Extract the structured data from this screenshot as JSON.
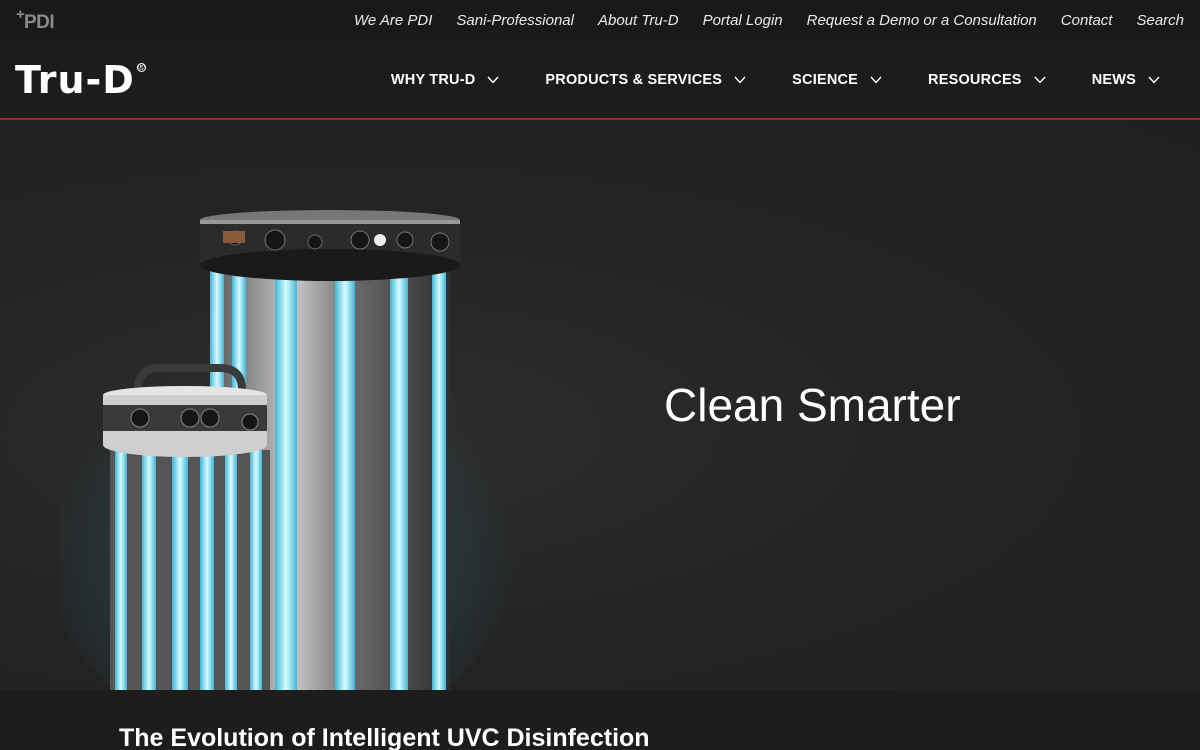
{
  "utility": {
    "brand": "PDI",
    "links": [
      "We Are PDI",
      "Sani-Professional",
      "About Tru-D",
      "Portal Login",
      "Request a Demo or a Consultation",
      "Contact",
      "Search"
    ]
  },
  "header": {
    "logo_text": "Tru-D",
    "logo_mark": "®",
    "nav": [
      {
        "label": "WHY TRU-D",
        "icon": "chevron-down-icon"
      },
      {
        "label": "PRODUCTS & SERVICES",
        "icon": "chevron-down-icon"
      },
      {
        "label": "SCIENCE",
        "icon": "chevron-down-icon"
      },
      {
        "label": "RESOURCES",
        "icon": "chevron-down-icon"
      },
      {
        "label": "NEWS",
        "icon": "chevron-down-icon"
      }
    ],
    "accent_color": "#a4262c"
  },
  "hero": {
    "title": "Clean Smarter",
    "image": "uvc-disinfection-robots"
  },
  "section": {
    "title": "The Evolution of Intelligent UVC Disinfection"
  }
}
